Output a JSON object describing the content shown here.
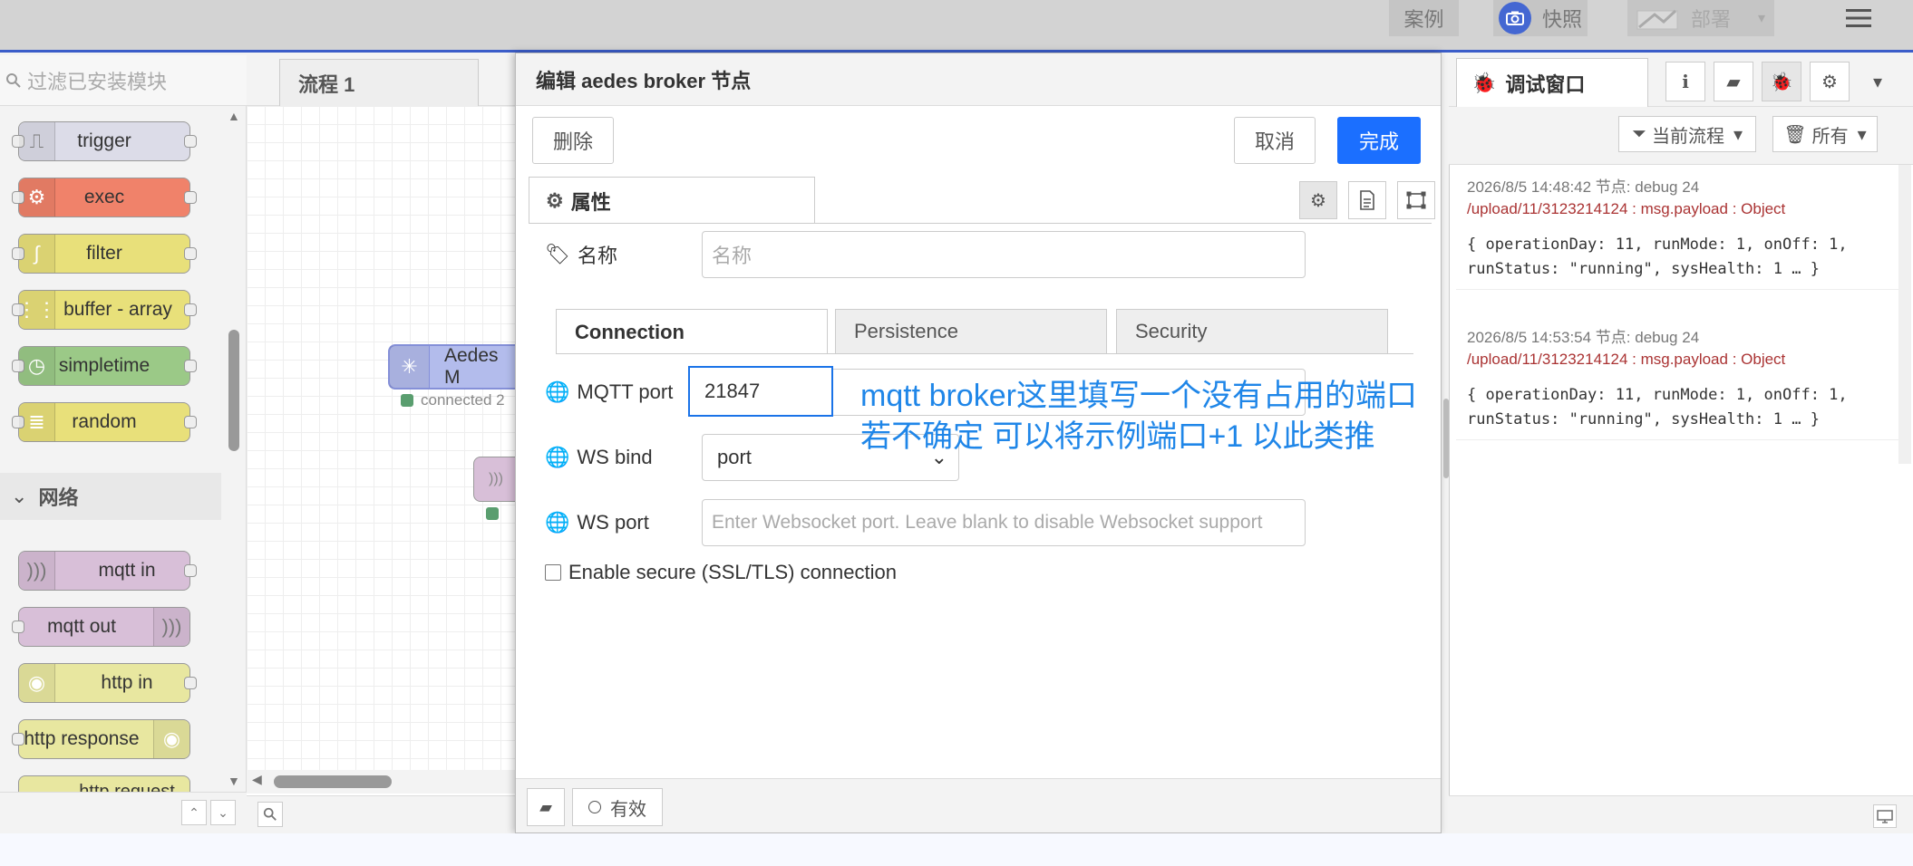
{
  "header": {
    "cases_label": "案例",
    "snapshot_label": "快照",
    "deploy_label": "部署"
  },
  "palette": {
    "search_placeholder": "过滤已安装模块",
    "nodes_top": [
      {
        "label": "trigger",
        "color": "#dcdce8"
      },
      {
        "label": "exec",
        "color": "#f0826a"
      },
      {
        "label": "filter",
        "color": "#e8e07a"
      },
      {
        "label": "buffer - array",
        "color": "#e8e07a"
      },
      {
        "label": "simpletime",
        "color": "#9bc987"
      },
      {
        "label": "random",
        "color": "#e8e07a"
      }
    ],
    "category_network": "网络",
    "nodes_network": [
      {
        "label": "mqtt in",
        "color": "#d8bfd8"
      },
      {
        "label": "mqtt out",
        "color": "#d8bfd8"
      },
      {
        "label": "http in",
        "color": "#e8e7a0"
      },
      {
        "label": "http response",
        "color": "#e8e7a0"
      },
      {
        "label": "http request",
        "color": "#e8e7a0"
      }
    ]
  },
  "workspace": {
    "tab_label": "流程 1",
    "node_label": "Aedes M",
    "node_status": "connected 2"
  },
  "editor": {
    "title": "编辑 aedes broker 节点",
    "delete_label": "删除",
    "cancel_label": "取消",
    "done_label": "完成",
    "tab_properties": "属性",
    "name_label": "名称",
    "name_placeholder": "名称",
    "subtabs": [
      "Connection",
      "Persistence",
      "Security"
    ],
    "mqtt_port_label": "MQTT port",
    "mqtt_port_value": "21847",
    "ws_bind_label": "WS bind",
    "ws_bind_value": "port",
    "ws_port_label": "WS port",
    "ws_port_placeholder": "Enter Websocket port. Leave blank to disable Websocket support",
    "ssl_label": "Enable secure (SSL/TLS) connection",
    "annotation_line1": "mqtt broker这里填写一个没有占用的端口",
    "annotation_line2": "若不确定 可以将示例端口+1 以此类推",
    "footer_enabled": "有效"
  },
  "sidebar": {
    "tab_debug": "调试窗口",
    "filter_flow": "当前流程",
    "filter_all": "所有",
    "messages": [
      {
        "meta": "2026/8/5 14:48:42   节点: debug 24",
        "topic": "/upload/11/3123214124 : msg.payload : Object"
      },
      {
        "meta": "2026/8/5 14:53:54   节点: debug 24",
        "topic": "/upload/11/3123214124 : msg.payload : Object"
      }
    ],
    "payload_text": "{ operationDay: 11, runMode: 1, onOff: 1, runStatus: \"running\", sysHealth: 1 … }"
  },
  "icons": {
    "camera": "camera-icon",
    "menu": "hamburger-menu-icon",
    "gear": "gear-icon",
    "tag": "tag-icon",
    "globe": "globe-icon",
    "bug": "bug-icon",
    "info": "info-icon",
    "book": "book-icon",
    "filter": "filter-icon",
    "trash": "trash-icon"
  },
  "colors": {
    "accent": "#1b6fff",
    "annotation": "#1f86e8",
    "header_bar": "#3b5dc9"
  }
}
